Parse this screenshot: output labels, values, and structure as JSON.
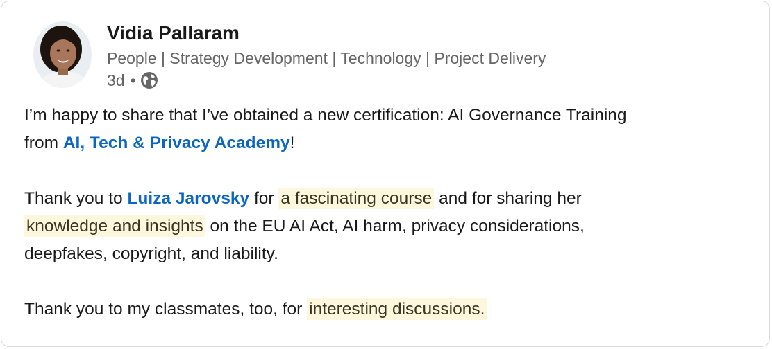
{
  "post": {
    "author_name": "Vidia Pallaram",
    "author_headline": "People | Strategy Development | Technology | Project Delivery",
    "timestamp": "3d",
    "separator": "•",
    "visibility_icon": "globe-icon",
    "avatar_icon": "profile-photo",
    "body": {
      "p1_text_a": "I’m happy to share that I’ve obtained a new certification: AI Governance Training",
      "p1_text_b": "from ",
      "p1_link": "AI, Tech & Privacy Academy",
      "p1_text_c": "!",
      "p2_text_a": "Thank you to ",
      "p2_link": "Luiza Jarovsky",
      "p2_text_b": " for ",
      "p2_hl_1": "a fascinating course",
      "p2_text_c": " and for sharing her",
      "p2_hl_2": "knowledge and insights",
      "p2_text_d": " on the EU AI Act, AI harm, privacy considerations,",
      "p2_text_e": "deepfakes, copyright, and liability.",
      "p3_text_a": "Thank you to my classmates, too, for ",
      "p3_hl": "interesting discussions."
    }
  },
  "colors": {
    "link": "#0a66c2",
    "highlight": "#fdf7dd",
    "secondary_text": "#666666"
  }
}
